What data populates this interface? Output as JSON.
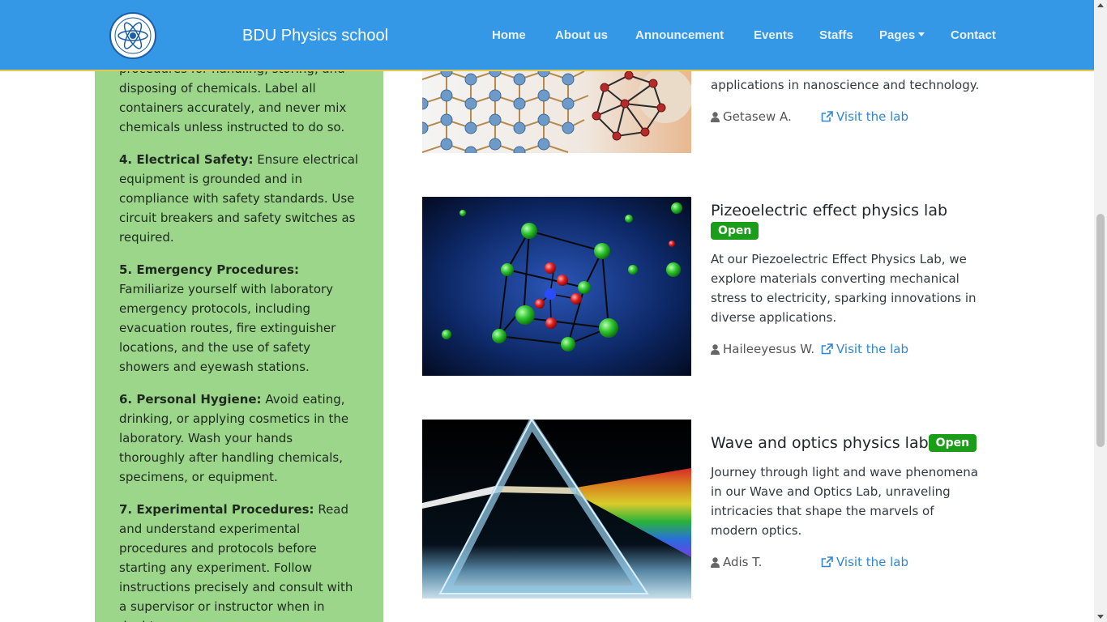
{
  "navbar": {
    "brand": "BDU Physics school",
    "items": [
      "Home",
      "About us",
      "Announcement",
      "Events",
      "Staffs",
      "Pages",
      "Contact"
    ],
    "color": "#3498e6"
  },
  "sidebar": {
    "partial_text": "procedures for handling, storing, and disposing of chemicals. Label all containers accurately, and never mix chemicals unless instructed to do so.",
    "rules": [
      {
        "title": "4. Electrical Safety:",
        "text": " Ensure electrical equipment is grounded and in compliance with safety standards. Use circuit breakers and safety switches as required."
      },
      {
        "title": "5. Emergency Procedures:",
        "text": " Familiarize yourself with laboratory emergency protocols, including evacuation routes, fire extinguisher locations, and the use of safety showers and eyewash stations."
      },
      {
        "title": "6. Personal Hygiene:",
        "text": " Avoid eating, drinking, or applying cosmetics in the laboratory. Wash your hands thoroughly after handling chemicals, specimens, or equipment."
      },
      {
        "title": "7. Experimental Procedures:",
        "text": " Read and understand experimental procedures and protocols before starting any experiment. Follow instructions precisely and consult with a supervisor or instructor when in doubt."
      }
    ],
    "color": "#9cd68a"
  },
  "labs": [
    {
      "title": "",
      "description_tail": "applications in nanoscience and technology.",
      "author": "Getasew A.",
      "link": "Visit the lab",
      "image_icon": "nanostructure-image"
    },
    {
      "title": "Pizeoelectric effect physics lab",
      "badge": "Open",
      "description": "At our Piezoelectric Effect Physics Lab, we explore materials converting mechanical stress to electricity, sparking innovations in diverse applications.",
      "author": "Haileeyesus W.",
      "link": "Visit the lab",
      "image_icon": "crystal-lattice-image"
    },
    {
      "title": "Wave and optics physics lab",
      "badge": "Open",
      "description": "Journey through light and wave phenomena in our Wave and Optics Lab, unraveling intricacies that shape the marvels of modern optics.",
      "author": "Adis T.",
      "link": "Visit the lab",
      "image_icon": "prism-image"
    }
  ],
  "badge_color": "#1a9e1a",
  "link_color": "#2f87d8"
}
